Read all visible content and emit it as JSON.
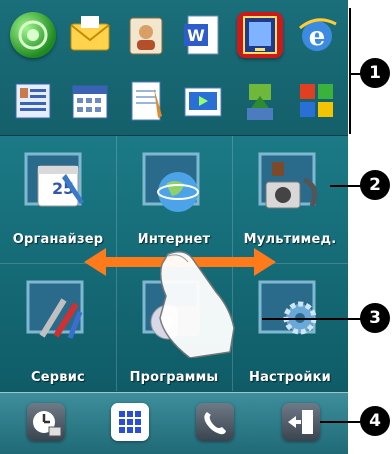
{
  "quick_launch": {
    "row1": [
      "green-orb-icon",
      "mail-envelope-icon",
      "contacts-card-icon",
      "word-document-icon",
      "pda-device-icon",
      "internet-explorer-icon"
    ],
    "row2": [
      "contacts-grid-icon",
      "calendar-icon",
      "notes-icon",
      "media-player-icon",
      "sync-icon",
      "windows-icon"
    ]
  },
  "tiles": [
    {
      "label": "Органайзер",
      "icon": "organizer-calendar-icon"
    },
    {
      "label": "Интернет",
      "icon": "internet-globe-icon"
    },
    {
      "label": "Мультимед.",
      "icon": "multimedia-camera-icon"
    },
    {
      "label": "Сервис",
      "icon": "service-tools-icon"
    },
    {
      "label": "Программы",
      "icon": "programs-disc-icon"
    },
    {
      "label": "Настройки",
      "icon": "settings-gear-icon"
    }
  ],
  "dock": [
    "clock-icon",
    "apps-grid-icon",
    "phone-icon",
    "exit-icon"
  ],
  "callouts": [
    "1",
    "2",
    "3",
    "4"
  ],
  "colors": {
    "screen_bg": "#0f5a66",
    "arrow": "#ff7a1a",
    "dock_selected": "#ffffff"
  }
}
